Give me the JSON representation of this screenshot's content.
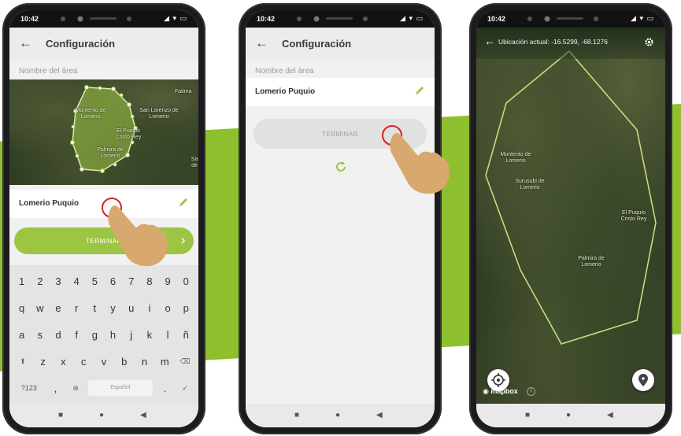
{
  "status_bar": {
    "time": "10:42",
    "icons": "signal-wifi-battery"
  },
  "phone1": {
    "title": "Configuración",
    "field_label": "Nombre del área",
    "area_name": "Lomerio Puquio",
    "button": "TERMINAR",
    "map_labels": [
      "Fatima",
      "Monterito de Lomerio",
      "San Lorenzo de Lomerio",
      "El Puquio Cristo Rey",
      "Palmira de Lomerio",
      "Sa de"
    ],
    "keyboard": {
      "row1": [
        "1",
        "2",
        "3",
        "4",
        "5",
        "6",
        "7",
        "8",
        "9",
        "0"
      ],
      "row2": [
        "q",
        "w",
        "e",
        "r",
        "t",
        "y",
        "u",
        "i",
        "o",
        "p"
      ],
      "row3": [
        "a",
        "s",
        "d",
        "f",
        "g",
        "h",
        "j",
        "k",
        "l",
        "ñ"
      ],
      "row4": [
        "z",
        "x",
        "c",
        "v",
        "b",
        "n",
        "m"
      ],
      "row5": {
        "symbols": "?123",
        "comma": ",",
        "space": "Español",
        "period": "."
      }
    }
  },
  "phone2": {
    "title": "Configuración",
    "field_label": "Nombre del área",
    "area_name": "Lomerio Puquio",
    "button": "TERMINAR"
  },
  "phone3": {
    "location": "Ubicación actual: -16.5299, -68.1276",
    "map_labels": [
      "Monterito de Lomerio",
      "Surusubi de Lomerio",
      "El Puquio Cristo Rey",
      "Palmira de Lomerio"
    ],
    "attribution": "mapbox"
  },
  "colors": {
    "accent_green": "#9cc544",
    "band_green": "#8dbf2f",
    "tap_red": "#d81f26"
  }
}
